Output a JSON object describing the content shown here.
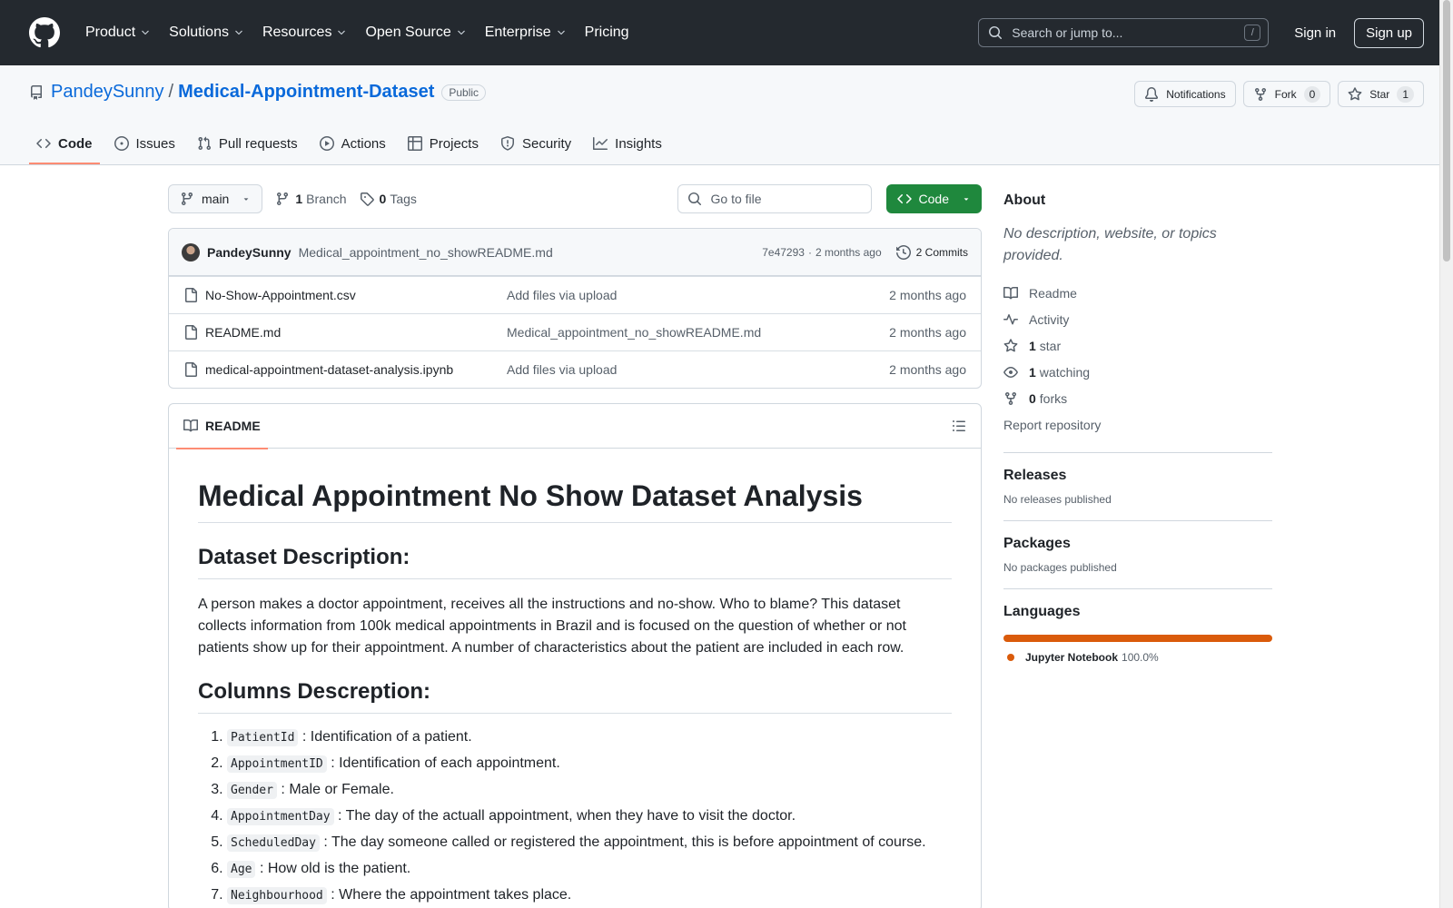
{
  "header": {
    "nav": [
      {
        "label": "Product",
        "has_menu": true
      },
      {
        "label": "Solutions",
        "has_menu": true
      },
      {
        "label": "Resources",
        "has_menu": true
      },
      {
        "label": "Open Source",
        "has_menu": true
      },
      {
        "label": "Enterprise",
        "has_menu": true
      },
      {
        "label": "Pricing",
        "has_menu": false
      }
    ],
    "search_placeholder": "Search or jump to...",
    "search_key": "/",
    "sign_in": "Sign in",
    "sign_up": "Sign up"
  },
  "repo": {
    "owner": "PandeySunny",
    "separator": "/",
    "name": "Medical-Appointment-Dataset",
    "visibility": "Public",
    "actions": {
      "notifications": "Notifications",
      "fork": "Fork",
      "fork_count": "0",
      "star": "Star",
      "star_count": "1"
    },
    "tabs": [
      {
        "label": "Code",
        "icon": "code-icon",
        "active": true
      },
      {
        "label": "Issues",
        "icon": "issue-icon",
        "active": false
      },
      {
        "label": "Pull requests",
        "icon": "pull-request-icon",
        "active": false
      },
      {
        "label": "Actions",
        "icon": "play-icon",
        "active": false
      },
      {
        "label": "Projects",
        "icon": "table-icon",
        "active": false
      },
      {
        "label": "Security",
        "icon": "shield-icon",
        "active": false
      },
      {
        "label": "Insights",
        "icon": "graph-icon",
        "active": false
      }
    ]
  },
  "toolbar": {
    "branch": "main",
    "branch_count": "1",
    "branch_label": "Branch",
    "tag_count": "0",
    "tag_label": "Tags",
    "goto_placeholder": "Go to file",
    "code_button": "Code"
  },
  "commit": {
    "author": "PandeySunny",
    "message": "Medical_appointment_no_showREADME.md",
    "sha": "7e47293",
    "dot": "·",
    "time": "2 months ago",
    "commits_label": "2 Commits"
  },
  "files": [
    {
      "name": "No-Show-Appointment.csv",
      "message": "Add files via upload",
      "date": "2 months ago"
    },
    {
      "name": "README.md",
      "message": "Medical_appointment_no_showREADME.md",
      "date": "2 months ago"
    },
    {
      "name": "medical-appointment-dataset-analysis.ipynb",
      "message": "Add files via upload",
      "date": "2 months ago"
    }
  ],
  "readme": {
    "tab_label": "README",
    "title": "Medical Appointment No Show Dataset Analysis",
    "section1_title": "Dataset Description:",
    "section1_text": "A person makes a doctor appointment, receives all the instructions and no-show. Who to blame? This dataset collects information from 100k medical appointments in Brazil and is focused on the question of whether or not patients show up for their appointment. A number of characteristics about the patient are included in each row.",
    "section2_title": "Columns Descreption:",
    "columns": [
      {
        "code": "PatientId",
        "desc": ": Identification of a patient."
      },
      {
        "code": "AppointmentID",
        "desc": ": Identification of each appointment."
      },
      {
        "code": "Gender",
        "desc": ": Male or Female."
      },
      {
        "code": "AppointmentDay",
        "desc": ": The day of the actuall appointment, when they have to visit the doctor."
      },
      {
        "code": "ScheduledDay",
        "desc": ": The day someone called or registered the appointment, this is before appointment of course."
      },
      {
        "code": "Age",
        "desc": ": How old is the patient."
      },
      {
        "code": "Neighbourhood",
        "desc": ": Where the appointment takes place."
      }
    ]
  },
  "sidebar": {
    "about_title": "About",
    "about_desc": "No description, website, or topics provided.",
    "links": {
      "readme": "Readme",
      "activity": "Activity",
      "stars_count": "1",
      "stars_label": "star",
      "watching_count": "1",
      "watching_label": "watching",
      "forks_count": "0",
      "forks_label": "forks",
      "report": "Report repository"
    },
    "releases_title": "Releases",
    "releases_text": "No releases published",
    "packages_title": "Packages",
    "packages_text": "No packages published",
    "languages_title": "Languages",
    "language": {
      "name": "Jupyter Notebook",
      "percent": "100.0%",
      "color": "#da5b0b"
    }
  }
}
